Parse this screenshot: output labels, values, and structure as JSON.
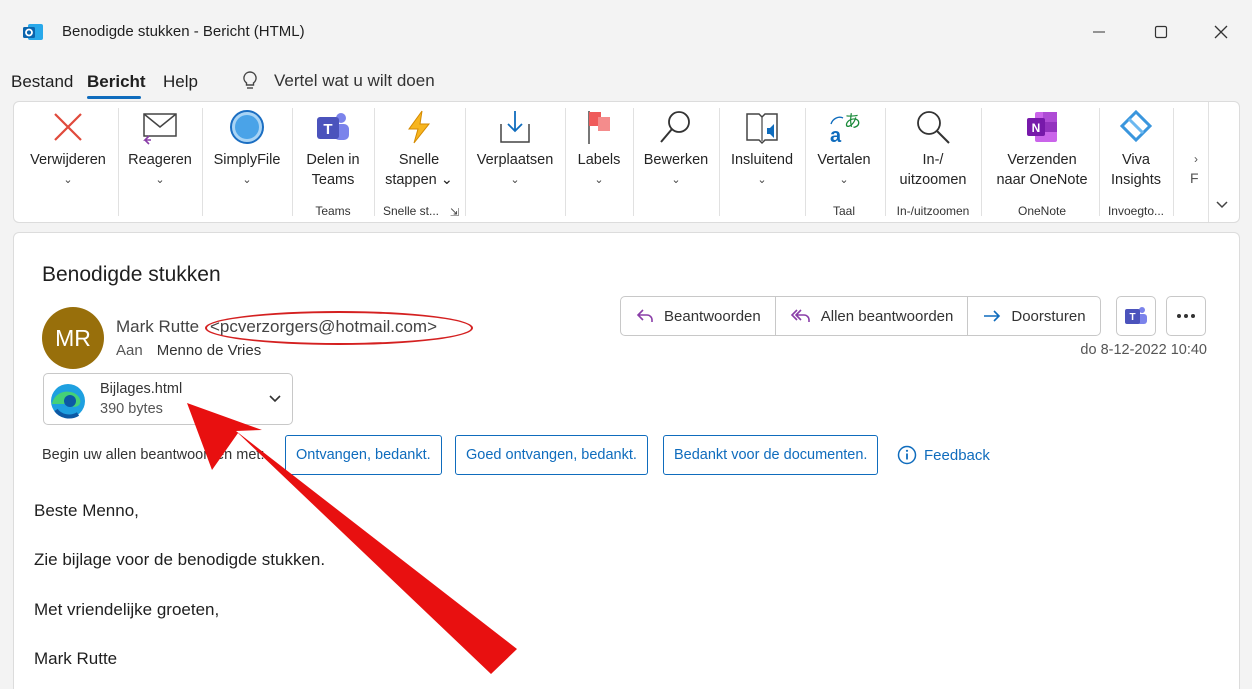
{
  "window": {
    "title": "Benodigde stukken  -  Bericht (HTML)",
    "app_icon": "outlook-icon"
  },
  "menu": {
    "tabs": [
      "Bestand",
      "Bericht",
      "Help"
    ],
    "active": "Bericht",
    "tellme": "Vertel wat u wilt doen"
  },
  "ribbon": {
    "buttons": [
      {
        "label": "Verwijderen",
        "icon": "delete-x-icon"
      },
      {
        "label": "Reageren",
        "icon": "reply-envelope-icon"
      },
      {
        "label": "SimplyFile",
        "icon": "simplyfile-icon"
      },
      {
        "label1": "Delen in",
        "label2": "Teams",
        "icon": "teams-icon"
      },
      {
        "label1": "Snelle",
        "label2": "stappen",
        "icon": "lightning-icon"
      },
      {
        "label": "Verplaatsen",
        "icon": "move-icon"
      },
      {
        "label": "Labels",
        "icon": "flag-icon"
      },
      {
        "label": "Bewerken",
        "icon": "magnifier-icon"
      },
      {
        "label": "Insluitend",
        "icon": "immersive-reader-icon"
      },
      {
        "label": "Vertalen",
        "icon": "translate-icon"
      },
      {
        "label1": "In-/",
        "label2": "uitzoomen",
        "icon": "zoom-icon"
      },
      {
        "label1": "Verzenden",
        "label2": "naar OneNote",
        "icon": "onenote-icon"
      },
      {
        "label1": "Viva",
        "label2": "Insights",
        "icon": "viva-insights-icon"
      }
    ],
    "groups": {
      "teams": "Teams",
      "quick": "Snelle st...",
      "taal": "Taal",
      "zoom": "In-/uitzoomen",
      "onenote": "OneNote",
      "addins": "Invoegto..."
    }
  },
  "message": {
    "subject": "Benodigde stukken",
    "avatar_initials": "MR",
    "avatar_color": "#986f0b",
    "sender_name": "Mark Rutte",
    "sender_email": "<pcverzorgers@hotmail.com>",
    "to_label": "Aan",
    "to_name": "Menno de Vries",
    "datetime": "do 8-12-2022 10:40",
    "actions": {
      "reply": "Beantwoorden",
      "reply_all": "Allen beantwoorden",
      "forward": "Doorsturen"
    },
    "attachment": {
      "name": "Bijlages.html",
      "size": "390 bytes"
    },
    "suggest_label": "Begin uw allen beantwoorden met:",
    "suggestions": [
      "Ontvangen, bedankt.",
      "Goed ontvangen, bedankt.",
      "Bedankt voor de documenten."
    ],
    "feedback": "Feedback",
    "body": [
      "Beste Menno,",
      "Zie bijlage voor de benodigde stukken.",
      "Met vriendelijke groeten,",
      "Mark Rutte"
    ]
  },
  "colors": {
    "accent": "#0f6cbd",
    "annotation": "#e81010"
  }
}
